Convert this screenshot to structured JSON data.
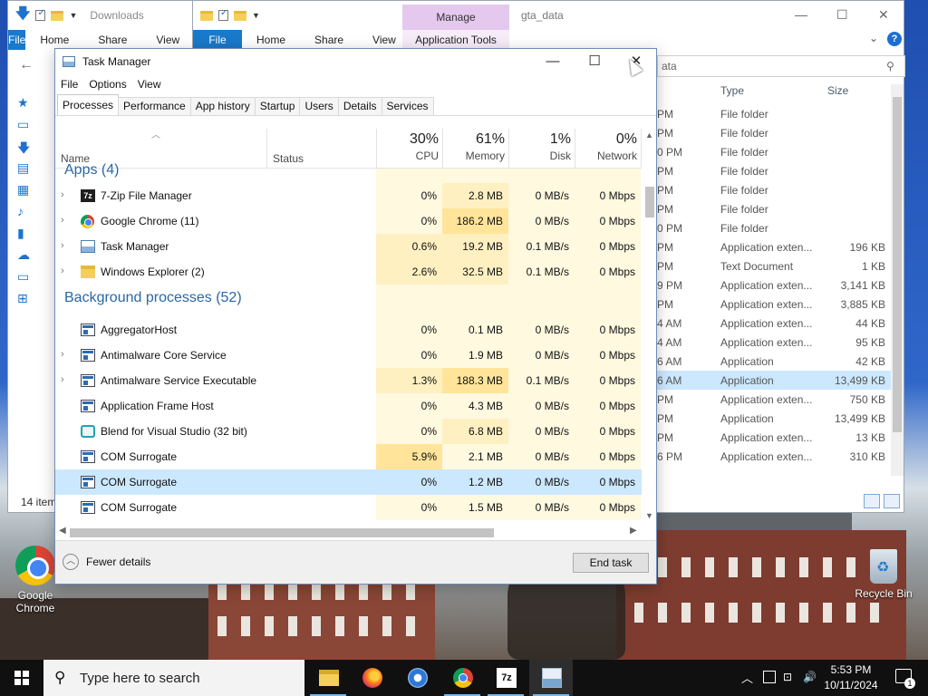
{
  "explorer_left": {
    "title": "Downloads",
    "ribbon_tabs": [
      "File",
      "Home",
      "Share",
      "View"
    ],
    "status": "14 item"
  },
  "explorer_right": {
    "title": "gta_data",
    "context_tab": "Manage",
    "context_group": "Application Tools",
    "ribbon_tabs": [
      "File",
      "Home",
      "Share",
      "View"
    ],
    "search_text": "ata",
    "columns": {
      "type": "Type",
      "size": "Size"
    },
    "files": [
      {
        "modified": "PM",
        "type": "File folder",
        "size": ""
      },
      {
        "modified": "PM",
        "type": "File folder",
        "size": ""
      },
      {
        "modified": "0 PM",
        "type": "File folder",
        "size": ""
      },
      {
        "modified": "PM",
        "type": "File folder",
        "size": ""
      },
      {
        "modified": "PM",
        "type": "File folder",
        "size": ""
      },
      {
        "modified": "PM",
        "type": "File folder",
        "size": ""
      },
      {
        "modified": "0 PM",
        "type": "File folder",
        "size": ""
      },
      {
        "modified": "PM",
        "type": "Application exten...",
        "size": "196 KB"
      },
      {
        "modified": "PM",
        "type": "Text Document",
        "size": "1 KB"
      },
      {
        "modified": "9 PM",
        "type": "Application exten...",
        "size": "3,141 KB"
      },
      {
        "modified": "PM",
        "type": "Application exten...",
        "size": "3,885 KB"
      },
      {
        "modified": "4 AM",
        "type": "Application exten...",
        "size": "44 KB"
      },
      {
        "modified": "4 AM",
        "type": "Application exten...",
        "size": "95 KB"
      },
      {
        "modified": "6 AM",
        "type": "Application",
        "size": "42 KB"
      },
      {
        "modified": "6 AM",
        "type": "Application",
        "size": "13,499 KB",
        "selected": true
      },
      {
        "modified": "PM",
        "type": "Application exten...",
        "size": "750 KB"
      },
      {
        "modified": "PM",
        "type": "Application",
        "size": "13,499 KB"
      },
      {
        "modified": "PM",
        "type": "Application exten...",
        "size": "13 KB"
      },
      {
        "modified": "6 PM",
        "type": "Application exten...",
        "size": "310 KB"
      }
    ]
  },
  "task_manager": {
    "title": "Task Manager",
    "menu": [
      "File",
      "Options",
      "View"
    ],
    "tabs": [
      "Processes",
      "Performance",
      "App history",
      "Startup",
      "Users",
      "Details",
      "Services"
    ],
    "active_tab": "Processes",
    "headers": {
      "name": "Name",
      "status": "Status",
      "cpu_pct": "30%",
      "cpu": "CPU",
      "mem_pct": "61%",
      "mem": "Memory",
      "disk_pct": "1%",
      "disk": "Disk",
      "net_pct": "0%",
      "net": "Network",
      "power": "P"
    },
    "groups": [
      {
        "name": "Apps (4)",
        "rows": [
          {
            "name": "7-Zip File Manager",
            "icon": "7zip-icon",
            "expandable": true,
            "cpu": "0%",
            "mem": "2.8 MB",
            "disk": "0 MB/s",
            "net": "0 Mbps",
            "cpu_heat": 0,
            "mem_heat": 1
          },
          {
            "name": "Google Chrome (11)",
            "icon": "chrome-icon",
            "expandable": true,
            "cpu": "0%",
            "mem": "186.2 MB",
            "disk": "0 MB/s",
            "net": "0 Mbps",
            "cpu_heat": 0,
            "mem_heat": 2
          },
          {
            "name": "Task Manager",
            "icon": "task-manager-icon",
            "expandable": true,
            "cpu": "0.6%",
            "mem": "19.2 MB",
            "disk": "0.1 MB/s",
            "net": "0 Mbps",
            "cpu_heat": 1,
            "mem_heat": 1
          },
          {
            "name": "Windows Explorer (2)",
            "icon": "explorer-icon",
            "expandable": true,
            "cpu": "2.6%",
            "mem": "32.5 MB",
            "disk": "0.1 MB/s",
            "net": "0 Mbps",
            "cpu_heat": 1,
            "mem_heat": 1
          }
        ]
      },
      {
        "name": "Background processes (52)",
        "rows": [
          {
            "name": "AggregatorHost",
            "icon": "service-icon",
            "expandable": false,
            "cpu": "0%",
            "mem": "0.1 MB",
            "disk": "0 MB/s",
            "net": "0 Mbps",
            "cpu_heat": 0,
            "mem_heat": 0
          },
          {
            "name": "Antimalware Core Service",
            "icon": "service-icon",
            "expandable": true,
            "cpu": "0%",
            "mem": "1.9 MB",
            "disk": "0 MB/s",
            "net": "0 Mbps",
            "cpu_heat": 0,
            "mem_heat": 0
          },
          {
            "name": "Antimalware Service Executable",
            "icon": "service-icon",
            "expandable": true,
            "cpu": "1.3%",
            "mem": "188.3 MB",
            "disk": "0.1 MB/s",
            "net": "0 Mbps",
            "cpu_heat": 1,
            "mem_heat": 2
          },
          {
            "name": "Application Frame Host",
            "icon": "service-icon",
            "expandable": false,
            "cpu": "0%",
            "mem": "4.3 MB",
            "disk": "0 MB/s",
            "net": "0 Mbps",
            "cpu_heat": 0,
            "mem_heat": 0
          },
          {
            "name": "Blend for Visual Studio (32 bit)",
            "icon": "blend-icon",
            "expandable": false,
            "cpu": "0%",
            "mem": "6.8 MB",
            "disk": "0 MB/s",
            "net": "0 Mbps",
            "cpu_heat": 0,
            "mem_heat": 1
          },
          {
            "name": "COM Surrogate",
            "icon": "service-icon",
            "expandable": false,
            "cpu": "5.9%",
            "mem": "2.1 MB",
            "disk": "0 MB/s",
            "net": "0 Mbps",
            "cpu_heat": 2,
            "mem_heat": 0
          },
          {
            "name": "COM Surrogate",
            "icon": "service-icon",
            "expandable": false,
            "cpu": "0%",
            "mem": "1.2 MB",
            "disk": "0 MB/s",
            "net": "0 Mbps",
            "cpu_heat": 0,
            "mem_heat": 0,
            "selected": true
          },
          {
            "name": "COM Surrogate",
            "icon": "service-icon",
            "expandable": false,
            "cpu": "0%",
            "mem": "1.5 MB",
            "disk": "0 MB/s",
            "net": "0 Mbps",
            "cpu_heat": 0,
            "mem_heat": 0
          }
        ]
      }
    ],
    "fewer_details": "Fewer details",
    "end_task": "End task"
  },
  "desktop_icons": [
    {
      "label": "Google Chrome",
      "icon": "chrome-icon"
    },
    {
      "label": "Recycle Bin",
      "icon": "recycle-bin-icon"
    }
  ],
  "taskbar": {
    "search_placeholder": "Type here to search",
    "apps": [
      "file-explorer-icon",
      "firefox-icon",
      "browser-icon",
      "chrome-icon",
      "7zip-icon",
      "task-manager-icon"
    ],
    "time": "5:53 PM",
    "date": "10/11/2024",
    "notifications": "1"
  },
  "colors": {
    "accent": "#1979ca",
    "selection": "#cce8ff",
    "heat0": "#fff9e0",
    "heat1": "#fff0c2",
    "heat2": "#ffe49a",
    "group_text": "#2868a6",
    "context_tab": "#e5c8ee"
  }
}
